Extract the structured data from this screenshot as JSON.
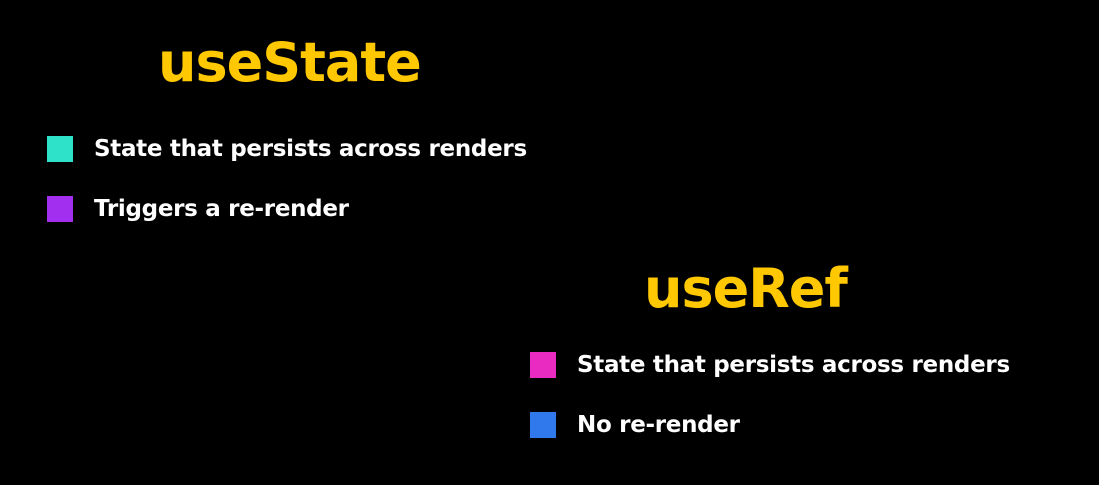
{
  "sections": [
    {
      "title": "useState",
      "bullets": [
        {
          "text": "State that persists across renders",
          "color": "#2de2c8"
        },
        {
          "text": "Triggers a re-render",
          "color": "#a22ff0"
        }
      ]
    },
    {
      "title": "useRef",
      "bullets": [
        {
          "text": "State that persists across renders",
          "color": "#ea2bc2"
        },
        {
          "text": "No re-render",
          "color": "#2f79ec"
        }
      ]
    }
  ],
  "colors": {
    "background": "#000000",
    "heading": "#ffc800",
    "text": "#ffffff"
  }
}
